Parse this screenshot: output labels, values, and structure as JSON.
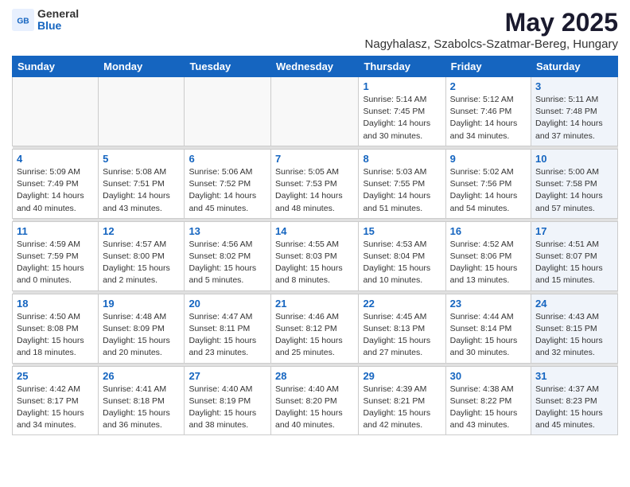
{
  "logo": {
    "general": "General",
    "blue": "Blue"
  },
  "title": "May 2025",
  "location": "Nagyhalasz, Szabolcs-Szatmar-Bereg, Hungary",
  "days_of_week": [
    "Sunday",
    "Monday",
    "Tuesday",
    "Wednesday",
    "Thursday",
    "Friday",
    "Saturday"
  ],
  "weeks": [
    [
      {
        "day": "",
        "detail": ""
      },
      {
        "day": "",
        "detail": ""
      },
      {
        "day": "",
        "detail": ""
      },
      {
        "day": "",
        "detail": ""
      },
      {
        "day": "1",
        "detail": "Sunrise: 5:14 AM\nSunset: 7:45 PM\nDaylight: 14 hours\nand 30 minutes."
      },
      {
        "day": "2",
        "detail": "Sunrise: 5:12 AM\nSunset: 7:46 PM\nDaylight: 14 hours\nand 34 minutes."
      },
      {
        "day": "3",
        "detail": "Sunrise: 5:11 AM\nSunset: 7:48 PM\nDaylight: 14 hours\nand 37 minutes."
      }
    ],
    [
      {
        "day": "4",
        "detail": "Sunrise: 5:09 AM\nSunset: 7:49 PM\nDaylight: 14 hours\nand 40 minutes."
      },
      {
        "day": "5",
        "detail": "Sunrise: 5:08 AM\nSunset: 7:51 PM\nDaylight: 14 hours\nand 43 minutes."
      },
      {
        "day": "6",
        "detail": "Sunrise: 5:06 AM\nSunset: 7:52 PM\nDaylight: 14 hours\nand 45 minutes."
      },
      {
        "day": "7",
        "detail": "Sunrise: 5:05 AM\nSunset: 7:53 PM\nDaylight: 14 hours\nand 48 minutes."
      },
      {
        "day": "8",
        "detail": "Sunrise: 5:03 AM\nSunset: 7:55 PM\nDaylight: 14 hours\nand 51 minutes."
      },
      {
        "day": "9",
        "detail": "Sunrise: 5:02 AM\nSunset: 7:56 PM\nDaylight: 14 hours\nand 54 minutes."
      },
      {
        "day": "10",
        "detail": "Sunrise: 5:00 AM\nSunset: 7:58 PM\nDaylight: 14 hours\nand 57 minutes."
      }
    ],
    [
      {
        "day": "11",
        "detail": "Sunrise: 4:59 AM\nSunset: 7:59 PM\nDaylight: 15 hours\nand 0 minutes."
      },
      {
        "day": "12",
        "detail": "Sunrise: 4:57 AM\nSunset: 8:00 PM\nDaylight: 15 hours\nand 2 minutes."
      },
      {
        "day": "13",
        "detail": "Sunrise: 4:56 AM\nSunset: 8:02 PM\nDaylight: 15 hours\nand 5 minutes."
      },
      {
        "day": "14",
        "detail": "Sunrise: 4:55 AM\nSunset: 8:03 PM\nDaylight: 15 hours\nand 8 minutes."
      },
      {
        "day": "15",
        "detail": "Sunrise: 4:53 AM\nSunset: 8:04 PM\nDaylight: 15 hours\nand 10 minutes."
      },
      {
        "day": "16",
        "detail": "Sunrise: 4:52 AM\nSunset: 8:06 PM\nDaylight: 15 hours\nand 13 minutes."
      },
      {
        "day": "17",
        "detail": "Sunrise: 4:51 AM\nSunset: 8:07 PM\nDaylight: 15 hours\nand 15 minutes."
      }
    ],
    [
      {
        "day": "18",
        "detail": "Sunrise: 4:50 AM\nSunset: 8:08 PM\nDaylight: 15 hours\nand 18 minutes."
      },
      {
        "day": "19",
        "detail": "Sunrise: 4:48 AM\nSunset: 8:09 PM\nDaylight: 15 hours\nand 20 minutes."
      },
      {
        "day": "20",
        "detail": "Sunrise: 4:47 AM\nSunset: 8:11 PM\nDaylight: 15 hours\nand 23 minutes."
      },
      {
        "day": "21",
        "detail": "Sunrise: 4:46 AM\nSunset: 8:12 PM\nDaylight: 15 hours\nand 25 minutes."
      },
      {
        "day": "22",
        "detail": "Sunrise: 4:45 AM\nSunset: 8:13 PM\nDaylight: 15 hours\nand 27 minutes."
      },
      {
        "day": "23",
        "detail": "Sunrise: 4:44 AM\nSunset: 8:14 PM\nDaylight: 15 hours\nand 30 minutes."
      },
      {
        "day": "24",
        "detail": "Sunrise: 4:43 AM\nSunset: 8:15 PM\nDaylight: 15 hours\nand 32 minutes."
      }
    ],
    [
      {
        "day": "25",
        "detail": "Sunrise: 4:42 AM\nSunset: 8:17 PM\nDaylight: 15 hours\nand 34 minutes."
      },
      {
        "day": "26",
        "detail": "Sunrise: 4:41 AM\nSunset: 8:18 PM\nDaylight: 15 hours\nand 36 minutes."
      },
      {
        "day": "27",
        "detail": "Sunrise: 4:40 AM\nSunset: 8:19 PM\nDaylight: 15 hours\nand 38 minutes."
      },
      {
        "day": "28",
        "detail": "Sunrise: 4:40 AM\nSunset: 8:20 PM\nDaylight: 15 hours\nand 40 minutes."
      },
      {
        "day": "29",
        "detail": "Sunrise: 4:39 AM\nSunset: 8:21 PM\nDaylight: 15 hours\nand 42 minutes."
      },
      {
        "day": "30",
        "detail": "Sunrise: 4:38 AM\nSunset: 8:22 PM\nDaylight: 15 hours\nand 43 minutes."
      },
      {
        "day": "31",
        "detail": "Sunrise: 4:37 AM\nSunset: 8:23 PM\nDaylight: 15 hours\nand 45 minutes."
      }
    ]
  ]
}
